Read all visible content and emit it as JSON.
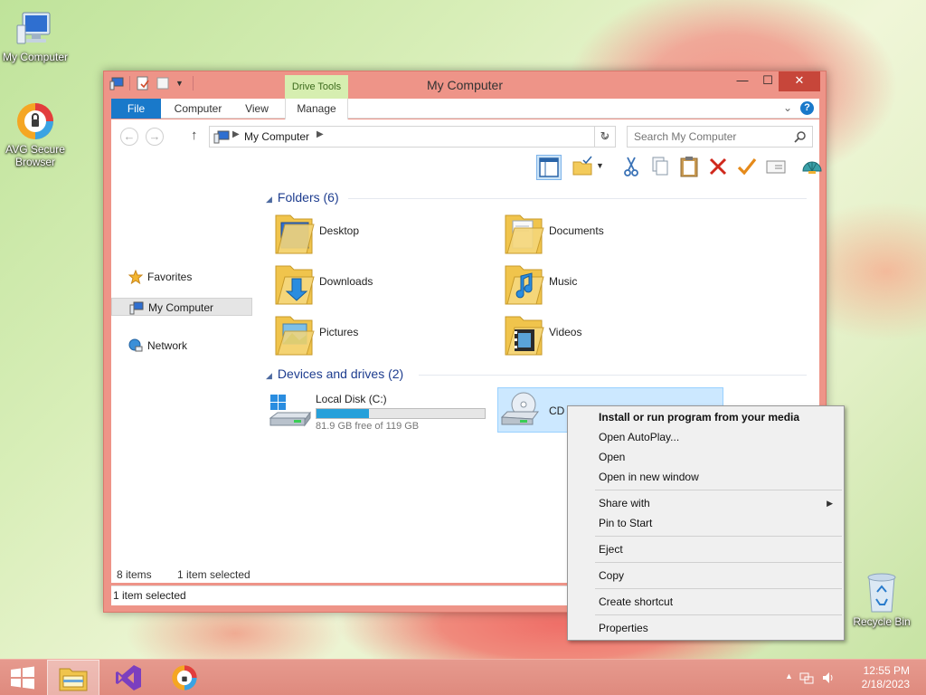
{
  "desktop": {
    "icons": [
      {
        "label": "My Computer"
      },
      {
        "label": "AVG Secure Browser"
      },
      {
        "label": "Recycle Bin"
      }
    ]
  },
  "window": {
    "title": "My Computer",
    "contextual_tab_group": "Drive Tools",
    "controls": {
      "minimize": "—",
      "maximize": "☐",
      "close": "✕"
    },
    "ribbon_tabs": [
      "File",
      "Computer",
      "View",
      "Manage"
    ],
    "help_label": "?",
    "address": {
      "path": "My Computer",
      "search_placeholder": "Search My Computer"
    },
    "nav": {
      "items": [
        "Favorites",
        "My Computer",
        "Network"
      ],
      "selected": "My Computer"
    },
    "groups": {
      "folders_title": "Folders (6)",
      "drives_title": "Devices and drives (2)"
    },
    "folders": [
      "Desktop",
      "Documents",
      "Downloads",
      "Music",
      "Pictures",
      "Videos"
    ],
    "drives": [
      {
        "name": "Local Disk (C:)",
        "free_text": "81.9 GB free of 119 GB",
        "used_fraction": 0.31
      },
      {
        "name": "CD"
      }
    ],
    "status": {
      "count": "8 items",
      "selection": "1 item selected",
      "bottom": "1 item selected"
    }
  },
  "context_menu": {
    "items": [
      {
        "label": "Install or run program from your media",
        "bold": true
      },
      {
        "label": "Open AutoPlay..."
      },
      {
        "label": "Open"
      },
      {
        "label": "Open in new window"
      },
      {
        "label": "Share with",
        "submenu": true
      },
      {
        "label": "Pin to Start"
      },
      {
        "label": "Eject"
      },
      {
        "label": "Copy"
      },
      {
        "label": "Create shortcut"
      },
      {
        "label": "Properties"
      }
    ]
  },
  "taskbar": {
    "time": "12:55 PM",
    "date": "2/18/2023"
  },
  "colors": {
    "accent": "#1979ca",
    "window_frame": "#ee9488",
    "close_button": "#c7463a",
    "selection": "#cce8ff",
    "drive_bar": "#26a0da"
  }
}
